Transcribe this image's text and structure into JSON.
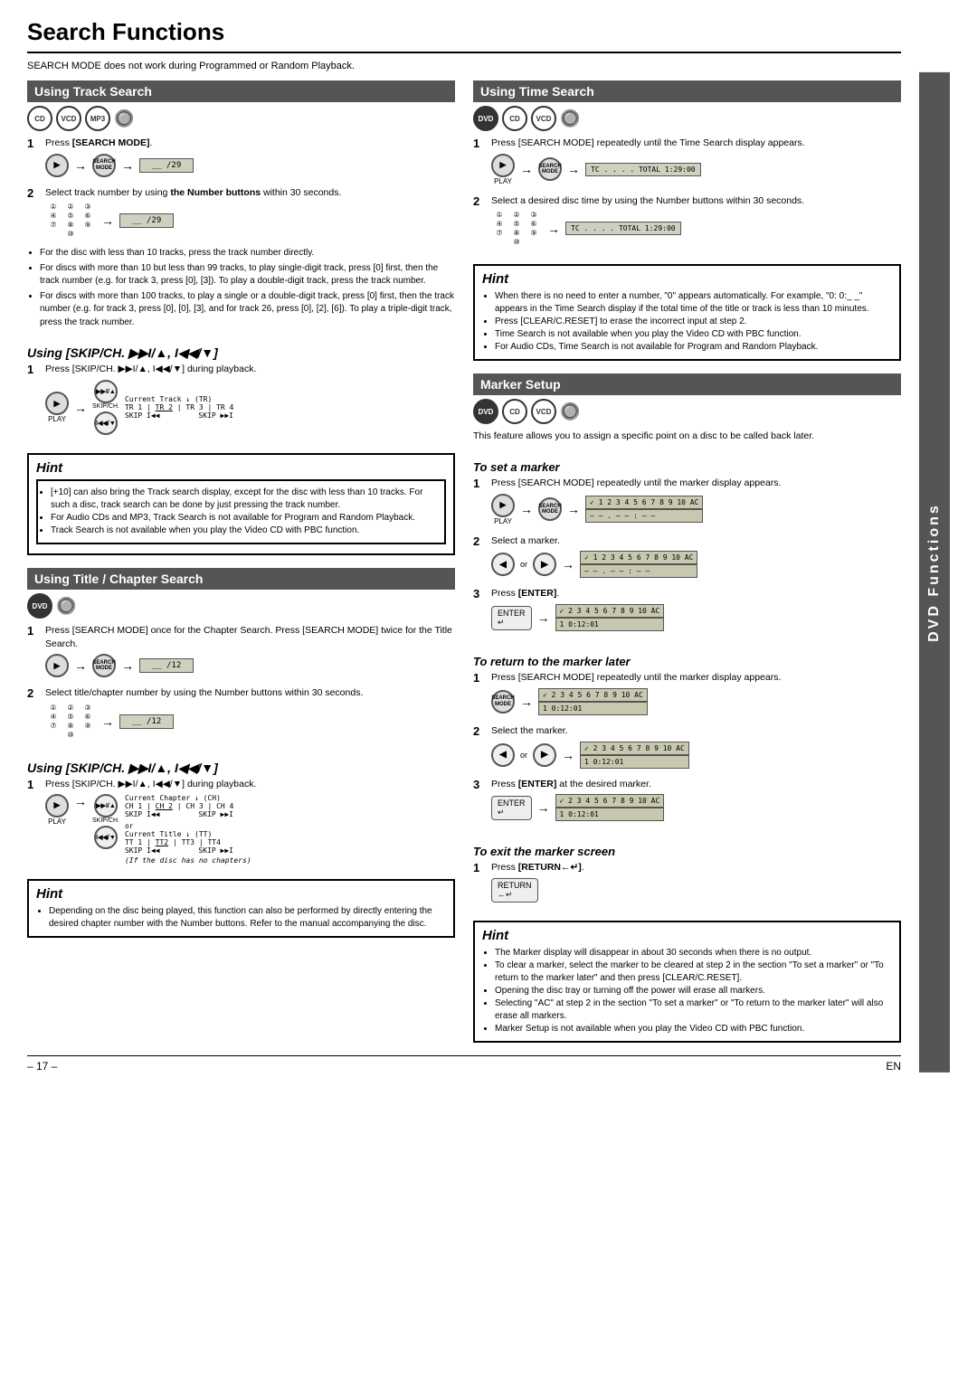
{
  "page": {
    "title": "Search Functions",
    "intro": "SEARCH MODE does not work during Programmed or Random Playback.",
    "page_number": "– 17 –",
    "page_suffix": "EN"
  },
  "left_col": {
    "track_search": {
      "header": "Using Track Search",
      "discs": [
        "CD",
        "VCD",
        "MP3"
      ],
      "step1_label": "1",
      "step1_text": "Press [SEARCH MODE].",
      "step1_display": "__ /29",
      "step2_label": "2",
      "step2_text": "Select track number by using the Number buttons within 30 seconds.",
      "step2_display": "__ /29",
      "bullets": [
        "For the disc with less than 10 tracks, press the track number directly.",
        "For discs with more than 10 but less than 99 tracks, to play single-digit track, press [0] first, then the track number (e.g. for track 3, press [0], [3]). To play a double-digit track, press the track number.",
        "For discs with more than 100 tracks, to play a single or a double-digit track, press [0] first, then the track number (e.g. for track 3, press [0], [0], [3], and for track 26, press [0], [2], [6]). To play a triple-digit track, press the track number."
      ]
    },
    "skip_ch_1": {
      "header": "Using [SKIP/CH. ▶▶I/▲, I◀◀/▼]",
      "step1_text": "Press [SKIP/CH. ▶▶I/▲, I◀◀/▼] during playback.",
      "diagram_labels": "TR 1  TR 2  TR 3  TR 4",
      "skip_label": "SKIP I◀◀        SKIP ▶▶I",
      "current_track": "Current Track ↓ (TR)"
    },
    "hint1": {
      "title": "Hint",
      "bullets": [
        "[+10] can also bring the Track search display, except for the disc with less than 10 tracks. For such a disc, track search can be done by just pressing the track number.",
        "For Audio CDs and MP3, Track Search is not available for Program and Random Playback.",
        "Track Search is not available when you play the Video CD with PBC function."
      ]
    },
    "title_chapter": {
      "header": "Using Title / Chapter Search",
      "discs": [
        "DVD"
      ],
      "step1_text": "Press [SEARCH MODE] once for the Chapter Search. Press [SEARCH MODE] twice for the Title Search.",
      "step1_display": "__ /12",
      "step2_text": "Select title/chapter number by using the Number buttons within 30 seconds.",
      "step2_display": "__ /12"
    },
    "skip_ch_2": {
      "header": "Using [SKIP/CH. ▶▶I/▲, I◀◀/▼]",
      "step1_text": "Press [SKIP/CH. ▶▶I/▲, I◀◀/▼] during playback.",
      "current_chapter": "Current Chapter ↓ (CH)",
      "chapter_labels": "CH 1  CH 2  CH 3  CH 4",
      "or_text": "or",
      "current_title": "Current Title ↓ (TT)",
      "title_labels": "TT 1  TT2  TT3  TT4",
      "skip_labels": "SKIP I◀◀        SKIP ▶▶I",
      "no_chapters_note": "(If the disc has no chapters)"
    },
    "hint2": {
      "title": "Hint",
      "bullets": [
        "Depending on the disc being played, this function can also be performed by directly entering the desired chapter number with the Number buttons. Refer to the manual accompanying the disc."
      ]
    }
  },
  "right_col": {
    "time_search": {
      "header": "Using Time Search",
      "discs": [
        "DVD",
        "CD",
        "VCD"
      ],
      "step1_text": "Press [SEARCH MODE] repeatedly until the Time Search display appears.",
      "step1_display": "TC . . . . TOTAL 1:29:00",
      "step2_text": "Select a desired disc time by using the Number buttons within 30 seconds.",
      "step2_display": "TC . . . . TOTAL 1:29:00"
    },
    "hint_time": {
      "title": "Hint",
      "bullets": [
        "When there is no need to enter a number, \"0\" appears automatically. For example, \"0: 0:_ _\" appears in the Time Search display if the total time of the title or track is less than 10 minutes.",
        "Press [CLEAR/C.RESET] to erase the incorrect input at step 2.",
        "Time Search is not available when you play the Video CD with PBC function.",
        "For Audio CDs, Time Search is not available for Program and Random Playback."
      ]
    },
    "marker_setup": {
      "header": "Marker Setup",
      "discs": [
        "DVD",
        "CD",
        "VCD"
      ],
      "intro": "This feature allows you to assign a specific point on a disc to be called back later."
    },
    "to_set_marker": {
      "title": "To set a marker",
      "step1_text": "Press [SEARCH MODE] repeatedly until the marker display appears.",
      "step1_display": "✓ 1 2 3 4 5 6 7 8 9 10 AC",
      "step1_display2": "– – . – – : – –",
      "step2_text": "Select a marker.",
      "step2_display": "✓ 1 2 3 4 5 6 7 8 9 10 AC",
      "step2_display2": "– – . – – : – –",
      "step3_text": "Press [ENTER].",
      "step3_display": "✓ 2 3 4 5 6 7 8 9 10 AC",
      "step3_display2": "1 0:12:01"
    },
    "to_return_marker": {
      "title": "To return to the marker later",
      "step1_text": "Press [SEARCH MODE] repeatedly until the marker display appears.",
      "step1_display": "✓ 2 3 4 5 6 7 8 9 10 AC",
      "step1_display2": "1 0:12:01",
      "step2_text": "Select the marker.",
      "step2_display": "✓ 2 3 4 5 6 7 8 9 10 AC",
      "step2_display2": "1 0:12:01",
      "step3_text": "Press [ENTER] at the desired marker.",
      "step3_display": "✓ 2 3 4 5 6 7 8 9 10 AC",
      "step3_display2": "1 0:12:01"
    },
    "to_exit_marker": {
      "title": "To exit the marker screen",
      "step1_text": "Press [RETURN←↵]."
    },
    "hint_marker": {
      "title": "Hint",
      "bullets": [
        "The Marker display will disappear in about 30 seconds when there is no output.",
        "To clear a marker, select the marker to be cleared at step 2 in the section \"To set a marker\" or \"To return to the marker later\" and then press [CLEAR/C.RESET].",
        "Opening the disc tray or turning off the power will erase all markers.",
        "Selecting \"AC\" at step 2 in the section \"To set a marker\" or \"To return to the marker later\" will also erase all markers.",
        "Marker Setup is not available when you play the Video CD with PBC function."
      ]
    }
  },
  "dvd_functions_tab": "DVD Functions"
}
